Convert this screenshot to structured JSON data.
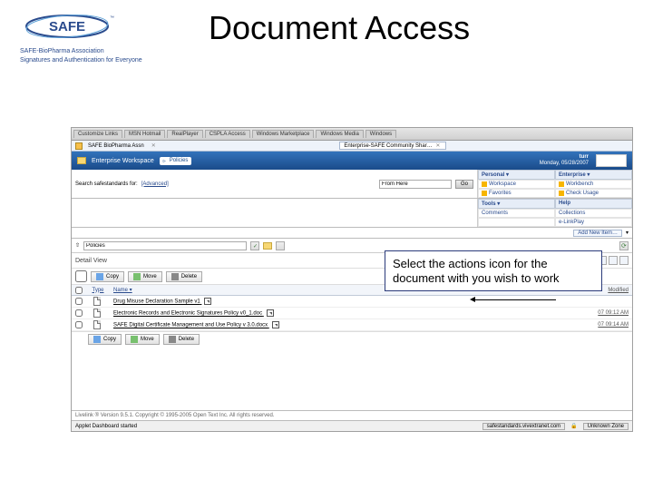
{
  "slide": {
    "title": "Document Access",
    "logo": {
      "brand": "SAFE",
      "tagline1": "SAFE-BioPharma Association",
      "tagline2": "Signatures and Authentication for Everyone"
    }
  },
  "callout": "Select the actions icon for the document with you wish to work",
  "tabs": [
    "Customize Links",
    "MSN Hotmail",
    "RealPlayer",
    "CSPLA Access",
    "Windows Marketplace",
    "Windows Media",
    "Windows"
  ],
  "hdr1": {
    "left": "SAFE BioPharma Assn",
    "mid": "Enterprise-SAFE Community Shar…"
  },
  "hdr2": {
    "ws": "Enterprise Workspace",
    "crumb": "Policies",
    "user": "turr",
    "date": "Monday, 05/28/2007"
  },
  "search": {
    "label": "Search safestandards for:",
    "advanced": "[Advanced]",
    "fromhere": "From Here",
    "go": "Go"
  },
  "panels": {
    "heads": [
      "Personal ▾",
      "Enterprise ▾",
      "Tools ▾",
      "Help"
    ],
    "links": [
      "Workspace",
      "Workbench",
      "Comments",
      "Collections",
      "Favorites",
      "Check Usage",
      "",
      "e-LinkPlay"
    ]
  },
  "addnew": "Add New Item…",
  "path": "Policies",
  "detail": "Detail View",
  "toolbar": {
    "copy": "Copy",
    "move": "Move",
    "delete": "Delete"
  },
  "table": {
    "head": {
      "type": "Type",
      "name": "Name ▾",
      "mod": "Modified"
    },
    "rows": [
      {
        "name": "Drug Misuse Declaration Sample v1",
        "mod": ""
      },
      {
        "name": "Electronic Records and Electronic Signatures Policy v0_1.doc",
        "mod": "07 09:12 AM"
      },
      {
        "name": "SAFE Digital Certificate Management and Use Policy v 3.0.docx",
        "mod": "07 09:14 AM"
      }
    ]
  },
  "footer": "Livelink ® Version 9.5.1. Copyright © 1995-2005 Open Text Inc. All rights reserved.",
  "status": {
    "left": "Applet Dashboard started",
    "url": "safestandards.vivextranet.com",
    "sec": "Unknown Zone"
  }
}
